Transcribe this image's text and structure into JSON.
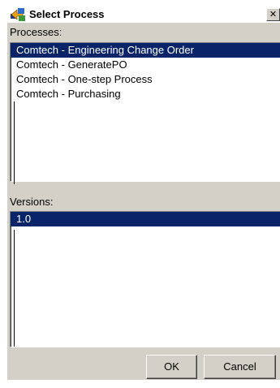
{
  "window": {
    "title": "Select Process",
    "close_symbol": "✕"
  },
  "processes": {
    "label": "Processes:",
    "items": [
      "Comtech - Engineering Change Order",
      "Comtech - GeneratePO",
      "Comtech - One-step Process",
      "Comtech - Purchasing"
    ],
    "selected_index": 0
  },
  "versions": {
    "label": "Versions:",
    "items": [
      "1.0"
    ],
    "selected_index": 0
  },
  "buttons": {
    "ok_label": "OK",
    "cancel_label": "Cancel"
  },
  "colors": {
    "selection": "#0a246a",
    "face": "#d4d0c8"
  },
  "icons": {
    "title": "puzzle-arrow-icon",
    "close": "close-icon"
  }
}
